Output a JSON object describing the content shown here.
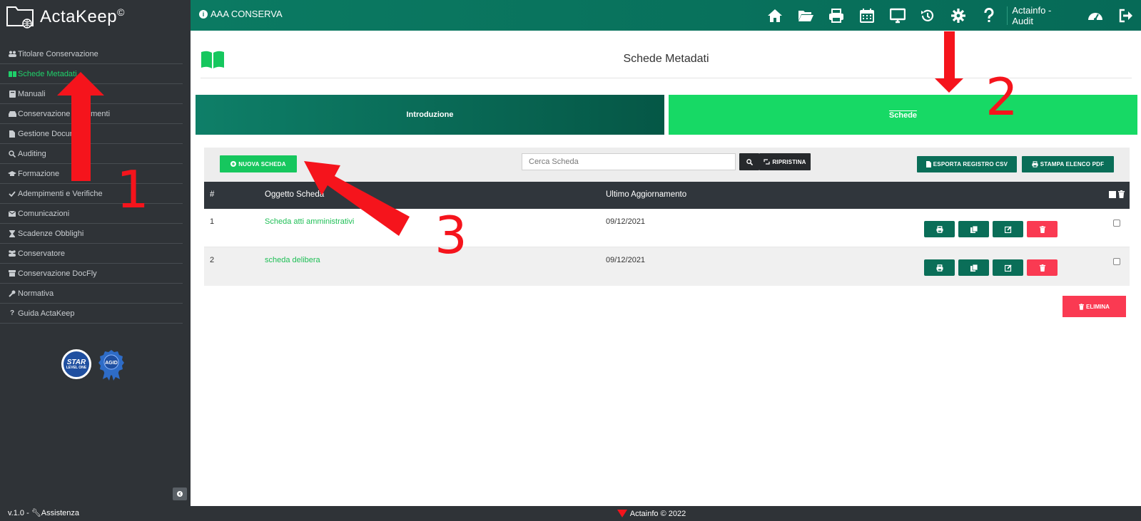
{
  "app": {
    "logo_text": "ActaKeep",
    "logo_sup": "©"
  },
  "sidebar": {
    "items": [
      {
        "label": "Titolare Conservazione",
        "icon": "users-icon"
      },
      {
        "label": "Schede Metadati",
        "icon": "book-icon",
        "active": true
      },
      {
        "label": "Manuali",
        "icon": "manual-icon"
      },
      {
        "label": "Conservazione Documenti",
        "icon": "inbox-icon"
      },
      {
        "label": "Gestione Documenti",
        "icon": "file-icon"
      },
      {
        "label": "Auditing",
        "icon": "search-icon"
      },
      {
        "label": "Formazione",
        "icon": "graduation-icon"
      },
      {
        "label": "Adempimenti e Verifiche",
        "icon": "check-icon"
      },
      {
        "label": "Comunicazioni",
        "icon": "envelope-icon"
      },
      {
        "label": "Scadenze Obblighi",
        "icon": "hourglass-icon"
      },
      {
        "label": "Conservatore",
        "icon": "group-icon"
      },
      {
        "label": "Conservazione DocFly",
        "icon": "archive-icon"
      },
      {
        "label": "Normativa",
        "icon": "wrench-icon"
      },
      {
        "label": "Guida ActaKeep",
        "icon": "question-icon"
      }
    ],
    "badge_star": "STAR",
    "badge_star_sub": "LEVEL ONE",
    "badge_agid": "AGID",
    "version": "v.1.0 -",
    "assist": "Assistenza"
  },
  "topbar": {
    "org": "AAA CONSERVA",
    "icons": [
      "home-icon",
      "folder-open-icon",
      "print-icon",
      "calendar-icon",
      "desktop-icon",
      "history-icon",
      "gear-icon",
      "question-icon"
    ],
    "user": "Actainfo - Audit"
  },
  "page": {
    "title": "Schede Metadati",
    "tab_intro": "Introduzione",
    "tab_schede": "Schede"
  },
  "toolbar": {
    "new_label": "NUOVA SCHEDA",
    "search_placeholder": "Cerca Scheda",
    "reset_label": "RIPRISTINA",
    "csv_label": "ESPORTA REGISTRO CSV",
    "pdf_label": "STAMPA ELENCO PDF"
  },
  "table": {
    "headers": {
      "num": "#",
      "oggetto": "Oggetto Scheda",
      "updated": "Ultimo Aggiornamento"
    },
    "rows": [
      {
        "num": "1",
        "oggetto": "Scheda atti amministrativi",
        "updated": "09/12/2021"
      },
      {
        "num": "2",
        "oggetto": "scheda delibera",
        "updated": "09/12/2021"
      }
    ],
    "delete_label": "ELIMINA"
  },
  "footer": {
    "text": "Actainfo © 2022"
  },
  "annotations": {
    "n1": "1",
    "n2": "2",
    "n3": "3"
  },
  "colors": {
    "accent_green": "#17d965",
    "dark_teal": "#0a6e58",
    "danger": "#fa3a52",
    "annotation_red": "#f5141c"
  }
}
